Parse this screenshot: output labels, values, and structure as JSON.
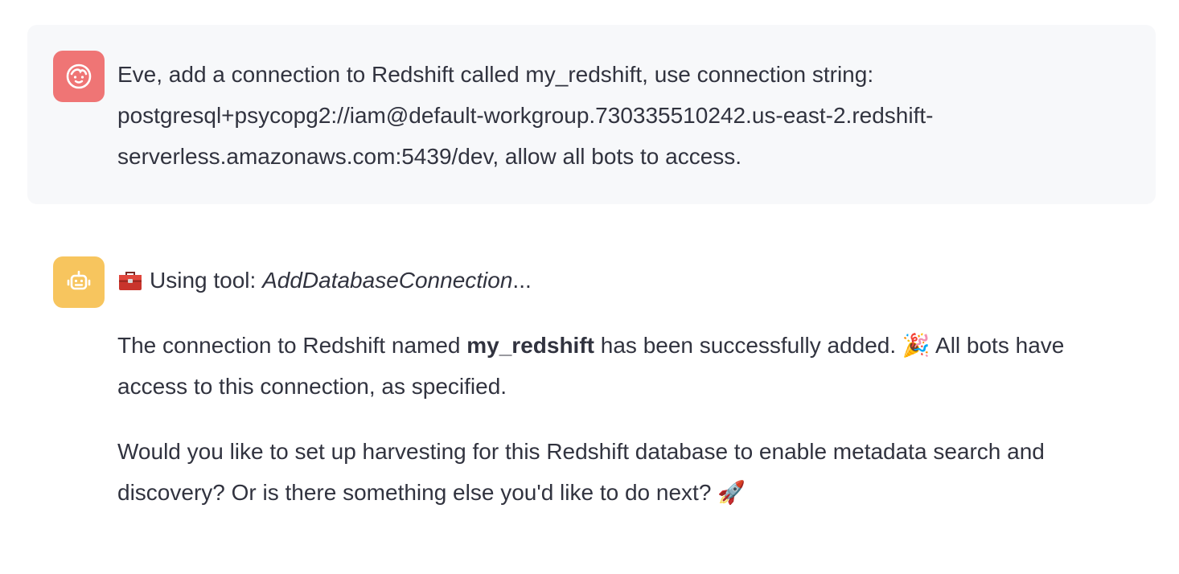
{
  "user_message": {
    "lines": [
      "Eve, add a connection to Redshift called my_redshift, use connection string:",
      "postgresql+psycopg2://iam@default-workgroup.730335510242.us-east-2.redshift-",
      "serverless.amazonaws.com:5439/dev, allow all bots to access."
    ]
  },
  "bot_message": {
    "tool_prefix": "Using tool: ",
    "tool_name": "AddDatabaseConnection",
    "tool_suffix": "...",
    "para1_before": "The connection to Redshift named ",
    "para1_bold": "my_redshift",
    "para1_after": " has been successfully added. ",
    "para1_emoji": "🎉",
    "para1_tail": " All bots have",
    "para1_line2": "access to this connection, as specified.",
    "para2_line1": "Would you like to set up harvesting for this Redshift database to enable metadata search and",
    "para2_line2": "discovery? Or is there something else you'd like to do next? ",
    "para2_emoji": "🚀"
  },
  "colors": {
    "user_avatar": "#ef7575",
    "bot_avatar": "#f7c55e",
    "user_bubble": "#f7f8fa",
    "text": "#31333f"
  },
  "icons": {
    "user_avatar": "user-face-icon",
    "bot_avatar": "robot-face-icon",
    "tool": "toolbox-icon"
  }
}
